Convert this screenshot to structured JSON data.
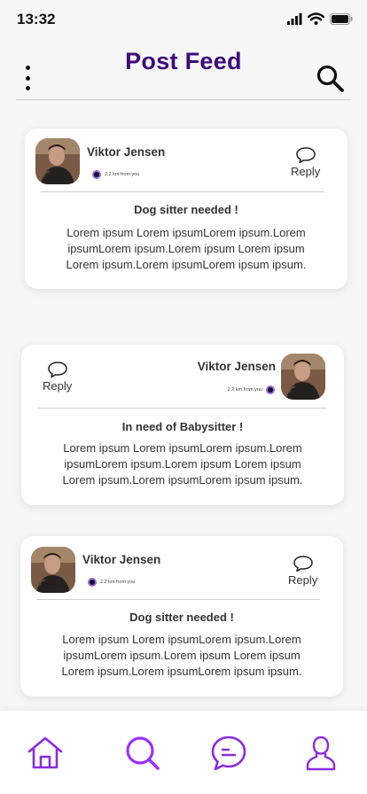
{
  "status_bar": {
    "time": "13:32"
  },
  "header": {
    "title": "Post Feed"
  },
  "posts": [
    {
      "author": "Viktor Jensen",
      "distance": "2.2 km from you",
      "reply_label": "Reply",
      "title": "Dog sitter needed !",
      "body_lines": [
        "Lorem ipsum Lorem ipsumLorem ipsum.Lorem",
        "ipsumLorem ipsum.Lorem ipsum Lorem ipsum",
        "Lorem ipsum.Lorem ipsumLorem ipsum ipsum."
      ]
    },
    {
      "author": "Viktor Jensen",
      "distance": "2.2 km from you",
      "reply_label": "Reply",
      "title": "In need of Babysitter !",
      "body_lines": [
        "Lorem ipsum Lorem ipsumLorem ipsum.Lorem",
        "ipsumLorem ipsum.Lorem ipsum Lorem ipsum",
        "Lorem ipsum.Lorem ipsumLorem ipsum ipsum."
      ]
    },
    {
      "author": "Viktor Jensen",
      "distance": "2.2 km from you",
      "reply_label": "Reply",
      "title": "Dog sitter needed !",
      "body_lines": [
        "Lorem ipsum Lorem ipsumLorem ipsum.Lorem",
        "ipsumLorem ipsum.Lorem ipsum Lorem ipsum",
        "Lorem ipsum.Lorem ipsumLorem ipsum ipsum."
      ]
    }
  ],
  "bottom_nav": {
    "items": [
      {
        "icon": "home-icon"
      },
      {
        "icon": "search-icon",
        "active": true
      },
      {
        "icon": "chat-icon"
      },
      {
        "icon": "profile-icon"
      }
    ]
  },
  "colors": {
    "title": "#3d0a7a",
    "nav_accent": "#8a2be2",
    "nav_active": "#9b30ff"
  }
}
